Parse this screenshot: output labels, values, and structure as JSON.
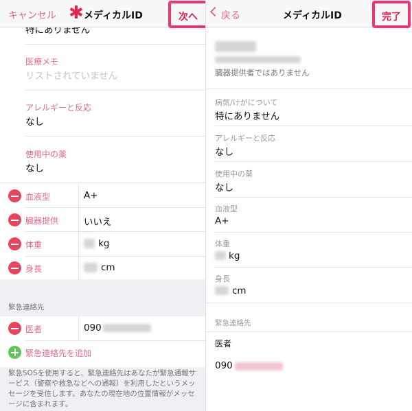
{
  "left": {
    "nav": {
      "cancel": "キャンセル",
      "asterisk": "✱",
      "title": "メディカルID",
      "next": "次へ"
    },
    "fields": {
      "condition_value": "特にありません",
      "notes_label": "医療メモ",
      "notes_value": "リストされていません",
      "allergies_label": "アレルギーと反応",
      "allergies_value": "なし",
      "medications_label": "使用中の薬",
      "medications_value": "なし"
    },
    "rows": [
      {
        "label": "血液型",
        "value": "A+"
      },
      {
        "label": "臓器提供",
        "value": "いいえ"
      },
      {
        "label": "体重",
        "value": "kg"
      },
      {
        "label": "身長",
        "value": "cm"
      }
    ],
    "emergency": {
      "section_title": "緊急連絡先",
      "contact_label": "医者",
      "contact_value": "090",
      "add_label": "緊急連絡先を追加",
      "footer": "緊急SOSを使用すると、緊急連絡先はあなたが緊急通報サービス（警察や救急などへの通報）を利用したというメッセージを受信します。あなたの現在地の位置情報がメッセージに含まれます。"
    }
  },
  "right": {
    "nav": {
      "back": "戻る",
      "title": "メディカルID",
      "done": "完了"
    },
    "organ_donor": "臓器提供者ではありません",
    "fields": [
      {
        "label": "病気/けがについて",
        "value": "特にありません"
      },
      {
        "label": "アレルギーと反応",
        "value": "なし"
      },
      {
        "label": "使用中の薬",
        "value": "なし"
      },
      {
        "label": "血液型",
        "value": "A+"
      },
      {
        "label": "体重",
        "value": "kg"
      },
      {
        "label": "身長",
        "value": "cm"
      }
    ],
    "emergency": {
      "section_title": "緊急連絡先",
      "contact_label": "医者",
      "contact_value": "090"
    }
  },
  "colors": {
    "accent": "#e06a86",
    "highlight": "#e8386d",
    "delete": "#e6455d",
    "add": "#5fc55a"
  }
}
